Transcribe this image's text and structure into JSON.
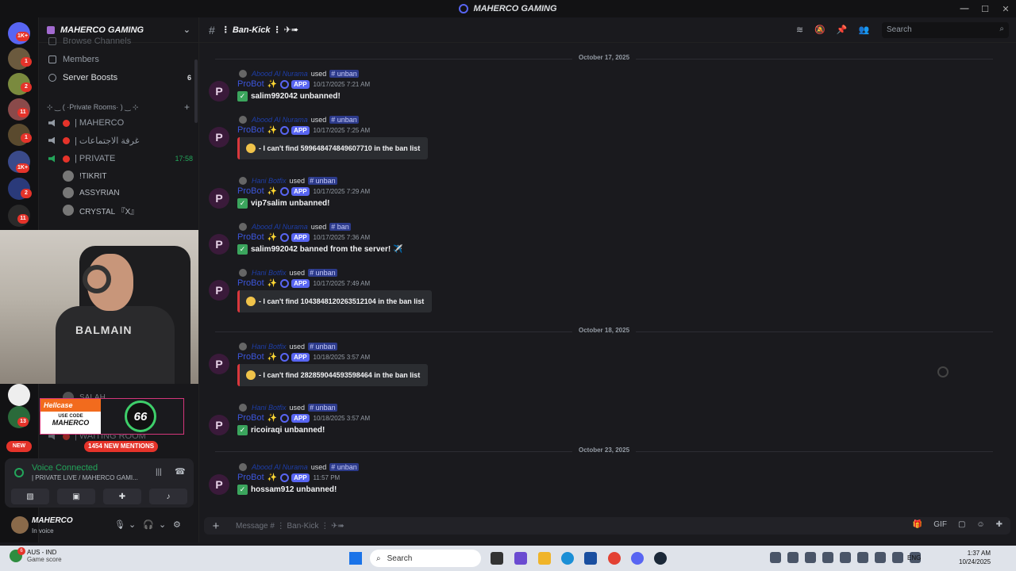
{
  "window": {
    "title": "MAHERCO GAMING",
    "controls": [
      "—",
      "☐",
      "✕"
    ]
  },
  "guild_badges": [
    "1K+",
    "1",
    "2",
    "11",
    "1",
    "1K+",
    "2",
    "11",
    "13",
    "NEW"
  ],
  "sidebar": {
    "server_name": "MAHERCO GAMING",
    "items": [
      {
        "label": "Browse Channels",
        "count": ""
      },
      {
        "label": "Members",
        "count": ""
      },
      {
        "label": "Server Boosts",
        "count": "6"
      }
    ],
    "category": "⊹ ‿ ( ·Private Rooms· ) ‿ ⊹",
    "voice_channels": [
      {
        "label": "| MAHERCO",
        "time": ""
      },
      {
        "label": "| غرفة الاجتماعات",
        "time": ""
      },
      {
        "label": "| PRIVATE",
        "time": "17:58"
      }
    ],
    "voice_users": [
      "!TIKRIT",
      "ASSYRIAN",
      "CRYSTAL 『X』"
    ],
    "hidden_channels": [
      "SALAH",
      "| WAITING ROOM"
    ]
  },
  "promo": {
    "brand": "Hellcase",
    "code_label": "USE CODE",
    "code": "MAHERCO",
    "score": "66"
  },
  "mentions": "1454 NEW MENTIONS",
  "new_badge": "NEW",
  "voice": {
    "status": "Voice Connected",
    "channel": "| PRIVATE LIVE / MAHERCO GAMI..."
  },
  "user": {
    "name": "MAHERCO",
    "status": "In voice"
  },
  "channel": {
    "name": "⋮ Ban-Kick ⋮ ✈➠"
  },
  "search_placeholder": "Search",
  "composer_placeholder": "Message # ⋮ Ban-Kick ⋮ ✈➠",
  "dates": [
    "October 17, 2025",
    "October 18, 2025",
    "October 23, 2025"
  ],
  "messages": [
    {
      "user": "Abood Al Nurama",
      "cmd": "unban",
      "bot": "ProBot",
      "time": "10/17/2025 7:21 AM",
      "text": "salim992042 unbanned!",
      "embed": false
    },
    {
      "user": "Abood Al Nurama",
      "cmd": "unban",
      "bot": "ProBot",
      "time": "10/17/2025 7:25 AM",
      "text": "- I can't find 599648474849607710 in the ban list",
      "embed": true
    },
    {
      "user": "Hani Botfix",
      "cmd": "unban",
      "bot": "ProBot",
      "time": "10/17/2025 7:29 AM",
      "text": "vip7salim unbanned!",
      "embed": false
    },
    {
      "user": "Abood Al Nurama",
      "cmd": "ban",
      "bot": "ProBot",
      "time": "10/17/2025 7:36 AM",
      "text": "salim992042 banned from the server! ✈️",
      "embed": false
    },
    {
      "user": "Hani Botfix",
      "cmd": "unban",
      "bot": "ProBot",
      "time": "10/17/2025 7:49 AM",
      "text": "- I can't find 1043848120263512104 in the ban list",
      "embed": true
    },
    {
      "user": "Hani Botfix",
      "cmd": "unban",
      "bot": "ProBot",
      "time": "10/18/2025 3:57 AM",
      "text": "- I can't find 282859044593598464 in the ban list",
      "embed": true
    },
    {
      "user": "Hani Botfix",
      "cmd": "unban",
      "bot": "ProBot",
      "time": "10/18/2025 3:57 AM",
      "text": "ricoiraqi unbanned!",
      "embed": false
    },
    {
      "user": "Abood Al Nurama",
      "cmd": "unban",
      "bot": "ProBot",
      "time": "11:57 PM",
      "text": "hossam912 unbanned!",
      "embed": false
    }
  ],
  "app_tag": "APP",
  "used_word": "used",
  "taskbar": {
    "weather_title": "AUS - IND",
    "weather_sub": "Game score",
    "weather_badge": "6",
    "search": "Search",
    "lang": "ENG",
    "time": "1:37 AM",
    "date": "10/24/2025"
  }
}
